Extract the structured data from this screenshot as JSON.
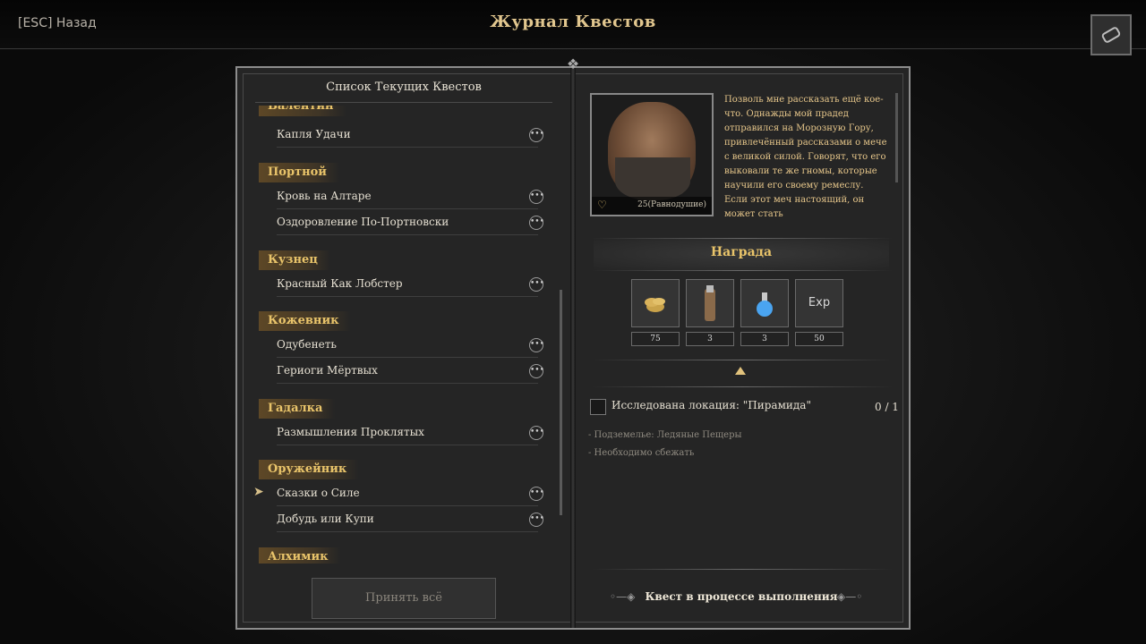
{
  "header": {
    "back_label": "[ESC] Назад",
    "title": "Журнал Квестов"
  },
  "left": {
    "list_title": "Список Текущих Квестов",
    "accept_all_label": "Принять всё",
    "categories": [
      {
        "name": "Валентин",
        "quests": [
          "Капля Удачи"
        ]
      },
      {
        "name": "Портной",
        "quests": [
          "Кровь на Алтаре",
          "Оздоровление По-Портновски"
        ]
      },
      {
        "name": "Кузнец",
        "quests": [
          "Красный Как Лобстер"
        ]
      },
      {
        "name": "Кожевник",
        "quests": [
          "Одубенеть",
          "Гериоги Мёртвых"
        ]
      },
      {
        "name": "Гадалка",
        "quests": [
          "Размышления Проклятых"
        ]
      },
      {
        "name": "Оружейник",
        "quests": [
          "Сказки о Силе",
          "Добудь или Купи"
        ]
      },
      {
        "name": "Алхимик",
        "quests": []
      }
    ],
    "selected_quest": "Сказки о Силе"
  },
  "right": {
    "portrait": {
      "relation_value": "25(Равнодушие)"
    },
    "description": "Позволь мне рассказать ещё кое-что. Однажды мой прадед отправился на Морозную Гору, привлечённый рассказами о мече с великой силой. Говорят, что его выковали те же гномы, которые научили его своему ремеслу. Если этот меч настоящий, он может стать",
    "reward_title": "Награда",
    "rewards": [
      {
        "icon": "gold-coins-icon",
        "value": "75"
      },
      {
        "icon": "scroll-item-icon",
        "value": "3"
      },
      {
        "icon": "blue-potion-icon",
        "value": "3"
      },
      {
        "icon": "exp-icon",
        "label": "Exp",
        "value": "50"
      }
    ],
    "objective": {
      "text": "Исследована локация: \"Пирамида\"",
      "progress": "0 / 1"
    },
    "notes": [
      "- Подземелье: Ледяные Пещеры",
      "- Необходимо сбежать"
    ],
    "status_label": "Квест в процессе выполнения"
  },
  "colors": {
    "accent_gold": "#e9c46a",
    "text_light": "#e6e0d2",
    "panel_bg": "#252525"
  }
}
